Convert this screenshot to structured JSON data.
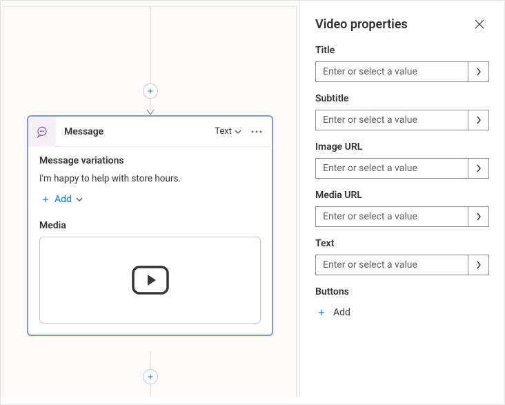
{
  "canvas": {
    "card": {
      "title": "Message",
      "type_label": "Text",
      "variations_label": "Message variations",
      "variation_text": "I'm happy to help with store hours.",
      "add_label": "Add",
      "media_label": "Media"
    }
  },
  "panel": {
    "title": "Video properties",
    "placeholder": "Enter or select a value",
    "fields": {
      "title": "Title",
      "subtitle": "Subtitle",
      "image_url": "Image URL",
      "media_url": "Media URL",
      "text": "Text",
      "buttons": "Buttons"
    },
    "buttons_add": "Add"
  }
}
